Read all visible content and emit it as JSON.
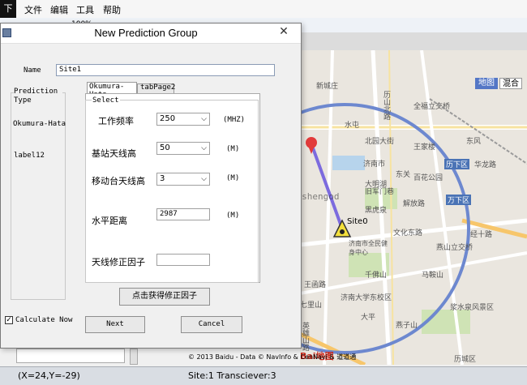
{
  "app": {
    "menu": [
      "文件",
      "编辑",
      "工具",
      "帮助"
    ],
    "logo": "下",
    "toolbar_text": "100%"
  },
  "map": {
    "mode_buttons": [
      "地图",
      "混合"
    ],
    "labels": [
      "新城庄",
      "历山北路",
      "全福立交桥",
      "水屯",
      "北园大街",
      "王家楼",
      "东风",
      "历下区",
      "华龙路",
      "济南市",
      "大明湖",
      "东关",
      "百花公园",
      "解放路",
      "万下区",
      "黑虎泉",
      "旧军门巷",
      "文化东路",
      "济南市全民健身中心",
      "燕山立交桥",
      "经十路",
      "千佛山",
      "马鞍山",
      "王函路",
      "七里山",
      "济南大学东校区",
      "大平",
      "英雄山路",
      "燕子山",
      "浆水泉风景区",
      "历城区"
    ],
    "site_label": "Site0",
    "watermark": "http://blog.csdn.net/buptgshengod",
    "copyright": "© 2013 Baidu - Data © NavInfo & CenNavi & 道道通",
    "baidu_logo": "Bai地图"
  },
  "status": {
    "coords": "(X=24,Y=-29)",
    "info": "Site:1 Transciever:3"
  },
  "dialog": {
    "title": "New Prediction Group",
    "close": "✕",
    "name_label": "Name",
    "name_value": "Site1",
    "prediction_type_label": "Prediction Type",
    "model_label": "Okumura-Hata",
    "label12": "label12",
    "tabs": [
      "Okumura-Hata",
      "tabPage2"
    ],
    "select_group": "Select",
    "freq_label": "工作频率",
    "freq_value": "250",
    "freq_unit": "(MHZ)",
    "base_height_label": "基站天线高",
    "base_height_value": "50",
    "base_height_unit": "(M)",
    "mobile_height_label": "移动台天线高",
    "mobile_height_value": "3",
    "mobile_height_unit": "(M)",
    "distance_label": "水平距离",
    "distance_value": "2987",
    "distance_unit": "(M)",
    "correction_label": "天线修正因子",
    "correction_value": "",
    "get_correction_button": "点击获得修正因子",
    "calculate_now": "Calculate Now",
    "next_button": "Next",
    "cancel_button": "Cancel"
  }
}
